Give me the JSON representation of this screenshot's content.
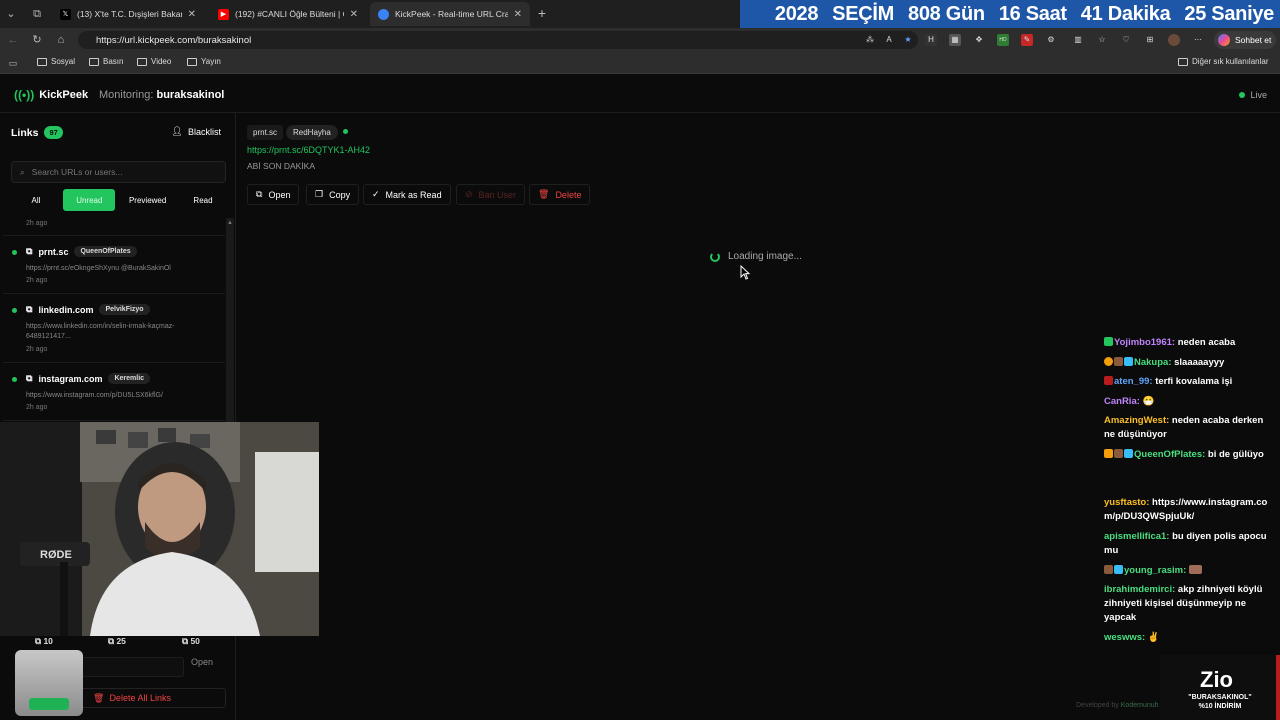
{
  "browser": {
    "tabs": [
      {
        "title": "(13) X'te T.C. Dışişleri Bakanlığı \"S",
        "icon": "x-icon"
      },
      {
        "title": "(192) #CANLI Öğle Bülteni | Can C",
        "icon": "youtube-icon"
      },
      {
        "title": "KickPeek - Real-time URL Cra",
        "icon": "kickpeek-icon",
        "active": true
      }
    ],
    "countdown": [
      "2028",
      "SEÇİM",
      "808 Gün",
      "16 Saat",
      "41 Dakika",
      "25 Saniye"
    ],
    "url": "https://url.kickpeek.com/buraksakinol",
    "sohbet_label": "Sohbet et",
    "bookmarks": [
      "Sosyal",
      "Basın",
      "Video",
      "Yayın"
    ],
    "bookmarks_right": "Diğer sık kullanılanlar"
  },
  "app": {
    "name": "KickPeek",
    "monitoring_label": "Monitoring:",
    "monitoring_user": "buraksakinol",
    "live_label": "Live",
    "accent": "#22c55e"
  },
  "sidebar": {
    "title": "Links",
    "count": "97",
    "blacklist_label": "Blacklist",
    "search_placeholder": "Search URLs or users...",
    "filters": [
      "All",
      "Unread",
      "Previewed",
      "Read"
    ],
    "top_ago": "2h ago",
    "items": [
      {
        "domain": "prnt.sc",
        "user": "QueenOfPlates",
        "url": "https://prnt.sc/eOkngeShXynu @BurakSakinOl",
        "ago": "2h ago"
      },
      {
        "domain": "linkedin.com",
        "user": "PelvikFizyo",
        "url": "https://www.linkedin.com/in/selin-irmak-kaçmaz-6489121417...",
        "ago": "2h ago"
      },
      {
        "domain": "instagram.com",
        "user": "Keremlic",
        "url": "https://www.instagram.com/p/DU5LSX6kflG/",
        "ago": "2h ago"
      }
    ],
    "bulk": [
      "10",
      "25",
      "50"
    ],
    "open_label": "Open",
    "delete_all_label": "Delete All Links"
  },
  "detail": {
    "domain": "prnt.sc",
    "user": "RedHayha",
    "url": "https://prnt.sc/6DQTYK1-AH42",
    "message": "ABİ SON DAKİKA",
    "actions": {
      "open": "Open",
      "copy": "Copy",
      "mark_read": "Mark as Read",
      "ban": "Ban User",
      "delete": "Delete"
    },
    "loading": "Loading image..."
  },
  "chat": [
    {
      "user": "Yojimbo1961:",
      "text": " neden acaba",
      "color": "#c084fc"
    },
    {
      "user": "Nakupa:",
      "text": " slaaaaayyy",
      "color": "#4ade80"
    },
    {
      "user": "aten_99:",
      "text": " terfi kovalama işi",
      "color": "#60a5fa"
    },
    {
      "user": "CanRia:",
      "text": " 😷",
      "color": "#c084fc"
    },
    {
      "user": "AmazingWest:",
      "text": " neden acaba derken ne düşünüyor",
      "color": "#fbbf24"
    },
    {
      "user": "QueenOfPlates:",
      "text": " bi de gülüyo",
      "color": "#4ade80"
    },
    {
      "user": "yusftasto:",
      "text": " https://www.instagram.com/p/DU3QWSpjuUk/",
      "color": "#fbbf24"
    },
    {
      "user": "apismellifica1:",
      "text": " bu diyen polis apocu mu",
      "color": "#4ade80"
    },
    {
      "user": "young_rasim:",
      "text": " ",
      "color": "#4ade80"
    },
    {
      "user": "ibrahimdemirci:",
      "text": " akp zihniyeti köylü zihniyeti kişisel düşünmeyip ne yapcak",
      "color": "#4ade80"
    },
    {
      "user": "weswws:",
      "text": " ✌",
      "color": "#4ade80"
    }
  ],
  "promo": {
    "logo": "Zio",
    "line1": "\"BURAKSAKINOL\"",
    "line2": "%10 İNDİRİM"
  },
  "footer": {
    "developed_by": "Developed by",
    "developer": "Kodemunuh"
  }
}
